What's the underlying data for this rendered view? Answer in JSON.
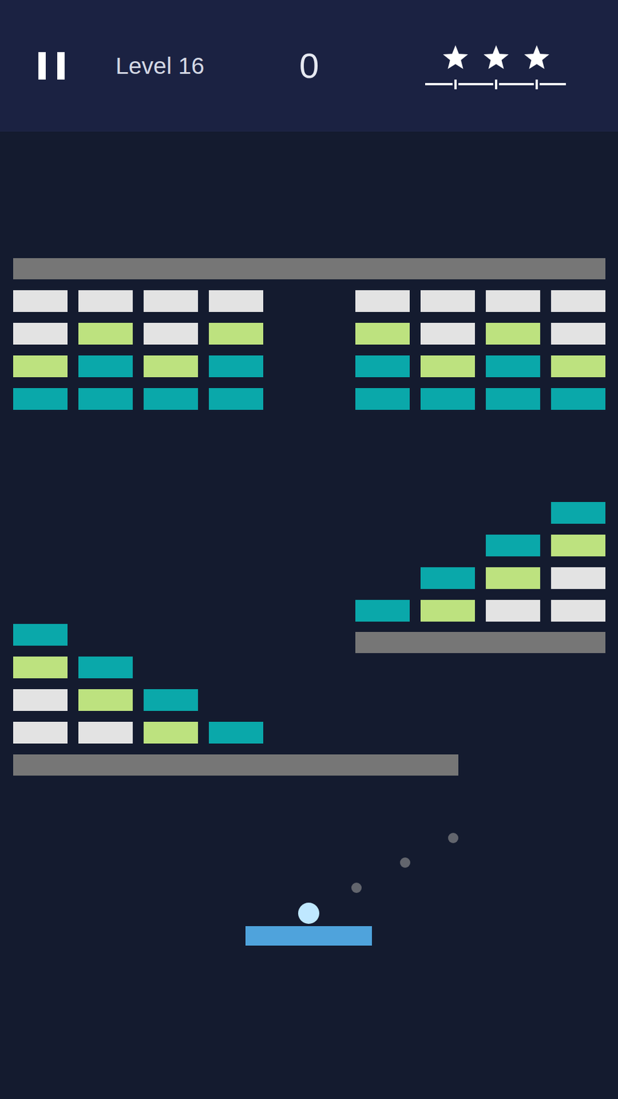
{
  "header": {
    "level": "Level 16",
    "score": "0",
    "stars": 3,
    "max_stars": 3
  },
  "field": {
    "walls": [
      {
        "breakable": false
      },
      {
        "breakable": false
      },
      {
        "breakable": false
      }
    ],
    "brick_groups": [
      {
        "rows": [
          [
            {
              "color": "#e3e3e3"
            },
            {
              "color": "#e3e3e3"
            },
            {
              "color": "#e3e3e3"
            },
            {
              "color": "#e3e3e3"
            }
          ],
          [
            {
              "color": "#e3e3e3"
            },
            {
              "color": "#bde27f"
            },
            {
              "color": "#e3e3e3"
            },
            {
              "color": "#bde27f"
            }
          ],
          [
            {
              "color": "#bde27f"
            },
            {
              "color": "#0aa8aa"
            },
            {
              "color": "#bde27f"
            },
            {
              "color": "#0aa8aa"
            }
          ],
          [
            {
              "color": "#0aa8aa"
            },
            {
              "color": "#0aa8aa"
            },
            {
              "color": "#0aa8aa"
            },
            {
              "color": "#0aa8aa"
            }
          ]
        ]
      },
      {
        "rows": [
          [
            {
              "color": "#e3e3e3"
            },
            {
              "color": "#e3e3e3"
            },
            {
              "color": "#e3e3e3"
            },
            {
              "color": "#e3e3e3"
            }
          ],
          [
            {
              "color": "#bde27f"
            },
            {
              "color": "#e3e3e3"
            },
            {
              "color": "#bde27f"
            },
            {
              "color": "#e3e3e3"
            }
          ],
          [
            {
              "color": "#0aa8aa"
            },
            {
              "color": "#bde27f"
            },
            {
              "color": "#0aa8aa"
            },
            {
              "color": "#bde27f"
            }
          ],
          [
            {
              "color": "#0aa8aa"
            },
            {
              "color": "#0aa8aa"
            },
            {
              "color": "#0aa8aa"
            },
            {
              "color": "#0aa8aa"
            }
          ]
        ]
      },
      {
        "rows": [
          [
            null,
            null,
            null,
            {
              "color": "#0aa8aa"
            }
          ],
          [
            null,
            null,
            {
              "color": "#0aa8aa"
            },
            {
              "color": "#bde27f"
            }
          ],
          [
            null,
            {
              "color": "#0aa8aa"
            },
            {
              "color": "#bde27f"
            },
            {
              "color": "#e3e3e3"
            }
          ],
          [
            {
              "color": "#0aa8aa"
            },
            {
              "color": "#bde27f"
            },
            {
              "color": "#e3e3e3"
            },
            {
              "color": "#e3e3e3"
            }
          ]
        ]
      },
      {
        "rows": [
          [
            {
              "color": "#0aa8aa"
            },
            null,
            null,
            null
          ],
          [
            {
              "color": "#bde27f"
            },
            {
              "color": "#0aa8aa"
            },
            null,
            null
          ],
          [
            {
              "color": "#e3e3e3"
            },
            {
              "color": "#bde27f"
            },
            {
              "color": "#0aa8aa"
            },
            null
          ],
          [
            {
              "color": "#e3e3e3"
            },
            {
              "color": "#e3e3e3"
            },
            {
              "color": "#bde27f"
            },
            {
              "color": "#0aa8aa"
            }
          ]
        ]
      }
    ],
    "aim_dots": 3
  }
}
